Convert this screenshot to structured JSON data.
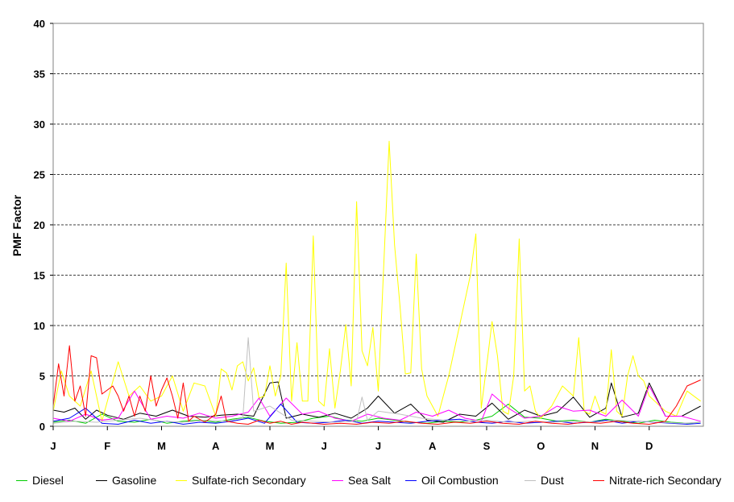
{
  "chart_data": {
    "type": "line",
    "title": "",
    "xlabel": "",
    "ylabel": "PMF Factor",
    "ylim": [
      0,
      40
    ],
    "yticks": [
      0,
      5,
      10,
      15,
      20,
      25,
      30,
      35,
      40
    ],
    "grid": "horizontal dashed",
    "legend": "bottom",
    "months": [
      "J",
      "F",
      "M",
      "A",
      "M",
      "J",
      "J",
      "A",
      "S",
      "O",
      "N",
      "D"
    ],
    "x_units": "month index (0 = start of J, 12 = end of D)",
    "series": [
      {
        "name": "Diesel",
        "color": "#00cc00",
        "x": [
          0,
          0.3,
          0.6,
          0.9,
          1.2,
          1.5,
          1.8,
          2.1,
          2.4,
          2.7,
          3.0,
          3.3,
          3.6,
          3.9,
          4.2,
          4.5,
          4.8,
          5.1,
          5.4,
          5.7,
          6.0,
          6.3,
          6.6,
          6.9,
          7.2,
          7.5,
          7.8,
          8.1,
          8.4,
          8.7,
          9.0,
          9.3,
          9.6,
          9.9,
          10.2,
          10.5,
          10.8,
          11.1,
          11.4,
          11.7,
          11.95
        ],
        "y": [
          0.4,
          0.6,
          0.3,
          1.2,
          0.5,
          0.4,
          0.7,
          0.3,
          0.5,
          0.6,
          0.4,
          0.7,
          0.9,
          0.5,
          0.3,
          0.4,
          0.8,
          1.0,
          0.6,
          0.5,
          0.8,
          0.6,
          0.4,
          0.3,
          0.5,
          0.4,
          0.6,
          1.0,
          2.2,
          0.9,
          0.8,
          0.5,
          0.6,
          0.4,
          0.7,
          0.5,
          0.3,
          0.6,
          0.4,
          0.3,
          0.4
        ]
      },
      {
        "name": "Gasoline",
        "color": "#000000",
        "x": [
          0,
          0.2,
          0.4,
          0.6,
          0.8,
          1.0,
          1.3,
          1.6,
          1.9,
          2.2,
          2.5,
          2.8,
          3.1,
          3.4,
          3.7,
          4.0,
          4.15,
          4.3,
          4.6,
          4.9,
          5.2,
          5.5,
          5.8,
          6.0,
          6.3,
          6.6,
          6.9,
          7.2,
          7.5,
          7.8,
          8.1,
          8.4,
          8.7,
          9.0,
          9.3,
          9.6,
          9.9,
          10.2,
          10.3,
          10.5,
          10.8,
          11.0,
          11.3,
          11.6,
          11.95
        ],
        "y": [
          1.6,
          1.4,
          1.8,
          0.7,
          1.6,
          1.1,
          0.7,
          1.3,
          1.0,
          1.6,
          1.0,
          0.9,
          1.1,
          1.2,
          1.0,
          4.3,
          4.4,
          0.8,
          1.2,
          0.9,
          1.3,
          0.8,
          1.8,
          3.0,
          1.3,
          2.2,
          0.6,
          0.4,
          1.2,
          1.0,
          2.3,
          0.7,
          1.6,
          1.0,
          1.4,
          2.9,
          0.9,
          1.8,
          4.3,
          0.9,
          1.3,
          4.3,
          1.0,
          1.0,
          2.0
        ]
      },
      {
        "name": "Sulfate-rich Secondary",
        "color": "#ffff00",
        "x": [
          0,
          0.15,
          0.3,
          0.5,
          0.7,
          0.9,
          1.0,
          1.2,
          1.4,
          1.6,
          1.8,
          2.0,
          2.2,
          2.4,
          2.6,
          2.8,
          3.0,
          3.1,
          3.2,
          3.3,
          3.4,
          3.5,
          3.6,
          3.7,
          3.8,
          3.9,
          4.0,
          4.1,
          4.2,
          4.3,
          4.4,
          4.5,
          4.6,
          4.7,
          4.8,
          4.9,
          5.0,
          5.1,
          5.2,
          5.3,
          5.4,
          5.5,
          5.6,
          5.7,
          5.8,
          5.9,
          6.0,
          6.2,
          6.3,
          6.4,
          6.5,
          6.6,
          6.7,
          6.8,
          6.9,
          7.1,
          7.3,
          7.5,
          7.7,
          7.8,
          7.9,
          8.0,
          8.1,
          8.2,
          8.3,
          8.4,
          8.5,
          8.6,
          8.7,
          8.8,
          8.9,
          9.0,
          9.2,
          9.4,
          9.6,
          9.7,
          9.8,
          9.9,
          10.0,
          10.1,
          10.2,
          10.3,
          10.4,
          10.5,
          10.6,
          10.7,
          10.8,
          10.9,
          11.0,
          11.1,
          11.3,
          11.5,
          11.7,
          11.95
        ],
        "y": [
          1.5,
          5.5,
          3.0,
          2.0,
          5.5,
          0.5,
          2.5,
          6.4,
          3.0,
          4.0,
          2.5,
          3.0,
          5.0,
          1.5,
          4.3,
          4.0,
          1.0,
          5.7,
          5.3,
          3.6,
          6.0,
          6.4,
          4.5,
          5.8,
          2.8,
          3.0,
          6.0,
          3.0,
          5.0,
          16.2,
          2.5,
          8.3,
          2.5,
          2.5,
          18.9,
          2.5,
          2.0,
          7.7,
          1.8,
          5.5,
          10.1,
          4.0,
          22.3,
          7.5,
          6.0,
          9.8,
          3.5,
          28.3,
          18.0,
          12.0,
          5.2,
          5.3,
          17.1,
          5.7,
          3.0,
          1.0,
          5.0,
          10.0,
          15.0,
          19.1,
          1.8,
          6.0,
          10.4,
          7.0,
          1.5,
          1.2,
          5.0,
          18.6,
          3.5,
          4.0,
          1.5,
          0.8,
          2.0,
          4.0,
          3.0,
          8.8,
          1.5,
          1.2,
          3.0,
          1.5,
          1.2,
          7.6,
          1.5,
          1.0,
          5.0,
          7.0,
          5.0,
          4.5,
          3.0,
          2.5,
          1.5,
          1.0,
          3.5,
          2.5
        ]
      },
      {
        "name": "Sea Salt",
        "color": "#ff00ff",
        "x": [
          0,
          0.3,
          0.6,
          0.9,
          1.2,
          1.5,
          1.8,
          2.1,
          2.4,
          2.7,
          3.0,
          3.3,
          3.6,
          3.8,
          4.0,
          4.3,
          4.6,
          4.9,
          5.2,
          5.5,
          5.8,
          6.1,
          6.4,
          6.7,
          7.0,
          7.3,
          7.6,
          7.9,
          8.1,
          8.4,
          8.7,
          9.0,
          9.3,
          9.6,
          9.9,
          10.2,
          10.5,
          10.8,
          11.0,
          11.3,
          11.6,
          11.95
        ],
        "y": [
          0.8,
          0.5,
          1.2,
          0.6,
          0.8,
          3.5,
          0.7,
          1.0,
          0.8,
          1.3,
          0.8,
          1.0,
          1.4,
          2.8,
          1.0,
          2.8,
          1.2,
          1.5,
          0.8,
          0.5,
          1.2,
          0.8,
          0.6,
          1.4,
          1.0,
          1.6,
          0.8,
          0.5,
          3.2,
          1.8,
          0.8,
          1.0,
          2.0,
          1.5,
          1.6,
          1.0,
          2.6,
          1.0,
          4.0,
          1.0,
          1.0,
          0.5
        ]
      },
      {
        "name": "Oil Combustion",
        "color": "#0000ff",
        "x": [
          0,
          0.3,
          0.6,
          0.9,
          1.2,
          1.5,
          1.8,
          2.1,
          2.4,
          2.7,
          3.0,
          3.3,
          3.6,
          3.9,
          4.2,
          4.5,
          4.8,
          5.1,
          5.4,
          5.7,
          6.0,
          6.3,
          6.6,
          6.9,
          7.2,
          7.5,
          7.8,
          8.1,
          8.4,
          8.7,
          9.0,
          9.3,
          9.6,
          9.9,
          10.2,
          10.5,
          10.8,
          11.1,
          11.4,
          11.7,
          11.95
        ],
        "y": [
          0.5,
          0.8,
          1.8,
          0.3,
          0.2,
          0.6,
          0.3,
          0.5,
          0.2,
          0.4,
          0.3,
          0.5,
          0.8,
          0.3,
          2.2,
          0.4,
          0.3,
          0.4,
          0.6,
          0.3,
          0.5,
          0.4,
          0.3,
          0.5,
          0.6,
          0.7,
          0.4,
          0.3,
          0.5,
          0.3,
          0.4,
          0.5,
          0.3,
          0.4,
          0.6,
          0.3,
          0.5,
          0.4,
          0.3,
          0.2,
          0.3
        ]
      },
      {
        "name": "Dust",
        "color": "#c0c0c0",
        "x": [
          0,
          0.4,
          0.8,
          1.2,
          1.6,
          2.0,
          2.4,
          2.8,
          3.2,
          3.5,
          3.6,
          3.7,
          4.0,
          4.4,
          4.8,
          5.2,
          5.6,
          5.7,
          5.8,
          6.0,
          6.4,
          6.8,
          7.2,
          7.6,
          8.0,
          8.4,
          8.8,
          9.2,
          9.6,
          10.0,
          10.4,
          10.8,
          11.2,
          11.6,
          11.95
        ],
        "y": [
          0.3,
          0.5,
          0.4,
          0.6,
          0.8,
          0.5,
          0.4,
          0.6,
          0.5,
          0.8,
          8.8,
          1.5,
          2.0,
          0.6,
          0.5,
          0.4,
          0.5,
          2.9,
          0.6,
          1.5,
          1.2,
          0.8,
          0.6,
          0.5,
          0.6,
          0.4,
          0.5,
          0.4,
          0.5,
          0.4,
          0.6,
          0.5,
          0.4,
          0.3,
          0.4
        ]
      },
      {
        "name": "Nitrate-rich Secondary",
        "color": "#ff0000",
        "x": [
          0,
          0.1,
          0.2,
          0.3,
          0.4,
          0.5,
          0.6,
          0.7,
          0.8,
          0.9,
          1.0,
          1.1,
          1.2,
          1.3,
          1.4,
          1.5,
          1.6,
          1.7,
          1.8,
          1.9,
          2.0,
          2.1,
          2.2,
          2.3,
          2.4,
          2.5,
          2.6,
          2.8,
          3.0,
          3.1,
          3.2,
          3.4,
          3.6,
          3.8,
          4.0,
          4.2,
          4.4,
          4.6,
          4.8,
          5.0,
          5.3,
          5.6,
          5.9,
          6.2,
          6.5,
          6.8,
          7.1,
          7.4,
          7.7,
          8.0,
          8.3,
          8.6,
          8.9,
          9.2,
          9.5,
          9.8,
          10.1,
          10.4,
          10.7,
          11.0,
          11.3,
          11.5,
          11.7,
          11.95
        ],
        "y": [
          2.0,
          6.2,
          3.0,
          8.0,
          2.5,
          4.0,
          1.0,
          7.0,
          6.8,
          3.2,
          3.6,
          4.0,
          3.0,
          1.5,
          3.0,
          1.0,
          3.0,
          1.5,
          5.0,
          2.0,
          3.6,
          4.8,
          3.0,
          0.8,
          4.3,
          0.5,
          1.0,
          0.4,
          1.2,
          3.0,
          0.5,
          0.3,
          0.2,
          0.6,
          0.3,
          0.5,
          0.2,
          0.4,
          0.3,
          0.2,
          0.3,
          0.2,
          0.4,
          0.3,
          0.5,
          0.3,
          0.2,
          0.4,
          0.3,
          0.5,
          0.3,
          0.2,
          0.5,
          0.3,
          0.2,
          0.4,
          0.3,
          0.5,
          0.3,
          0.2,
          0.5,
          2.0,
          4.0,
          4.6
        ]
      }
    ]
  }
}
